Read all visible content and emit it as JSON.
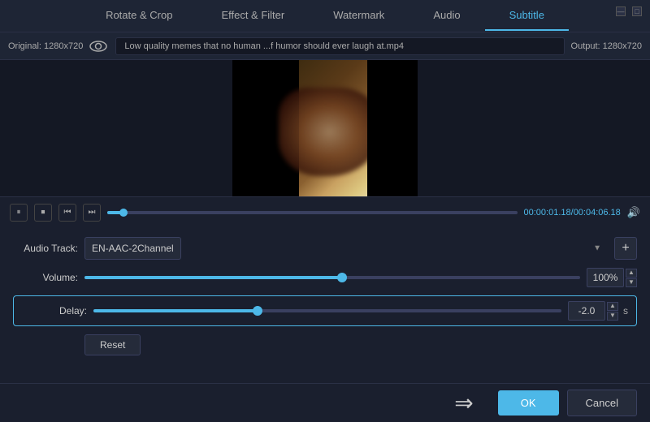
{
  "window": {
    "minimize_label": "—",
    "maximize_label": "□",
    "close_label": "✕"
  },
  "tabs": [
    {
      "id": "rotate-crop",
      "label": "Rotate & Crop",
      "active": false
    },
    {
      "id": "effect-filter",
      "label": "Effect & Filter",
      "active": false
    },
    {
      "id": "watermark",
      "label": "Watermark",
      "active": false
    },
    {
      "id": "audio",
      "label": "Audio",
      "active": true
    },
    {
      "id": "subtitle",
      "label": "Subtitle",
      "active": false
    }
  ],
  "info_bar": {
    "original_label": "Original: 1280x720",
    "filename": "Low quality memes that no human ...f humor should ever laugh at.mp4",
    "output_label": "Output: 1280x720"
  },
  "playback": {
    "time_current": "00:00:01.18",
    "time_total": "00:04:06.18",
    "progress_percent": 4
  },
  "audio": {
    "track_label": "Audio Track:",
    "track_value": "EN-AAC-2Channel",
    "volume_label": "Volume:",
    "volume_value": "100%",
    "volume_percent": 52,
    "delay_label": "Delay:",
    "delay_value": "-2.0",
    "delay_unit": "s",
    "delay_percent": 35,
    "reset_label": "Reset"
  },
  "bottom": {
    "ok_label": "OK",
    "cancel_label": "Cancel"
  }
}
